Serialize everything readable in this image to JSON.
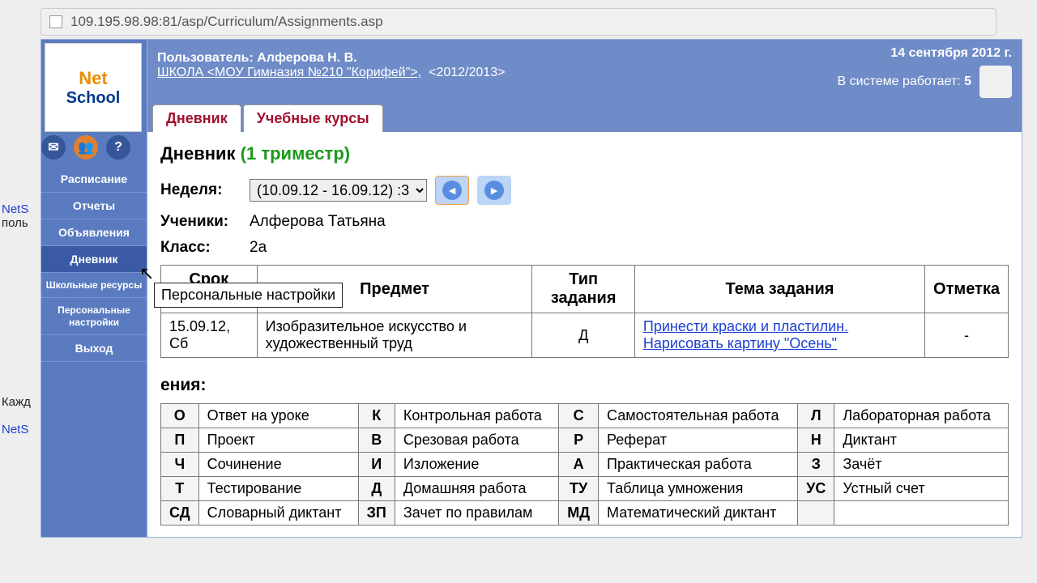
{
  "browser": {
    "url": "109.195.98.98:81/asp/Curriculum/Assignments.asp"
  },
  "header": {
    "user_label": "Пользователь:",
    "user_name": "Алферова Н. В.",
    "school": "ШКОЛА <МОУ Гимназия №210 \"Корифей\">,",
    "year": "<2012/2013>",
    "date": "14 сентября 2012 г.",
    "sys_label": "В системе работает:",
    "sys_count": "5"
  },
  "logo": {
    "net": "Net",
    "school": "School"
  },
  "sidebar": {
    "items": [
      {
        "label": "Расписание"
      },
      {
        "label": "Отчеты"
      },
      {
        "label": "Объявления"
      },
      {
        "label": "Дневник",
        "active": true
      },
      {
        "label": "Школьные ресурсы",
        "small": true
      },
      {
        "label": "Персональные настройки",
        "small": true
      },
      {
        "label": "Выход"
      }
    ]
  },
  "tabs": [
    {
      "label": "Дневник",
      "active": true
    },
    {
      "label": "Учебные курсы"
    }
  ],
  "page": {
    "title": "Дневник",
    "term": "(1 триместр)",
    "week_label": "Неделя:",
    "week_value": "(10.09.12 - 16.09.12) :3",
    "pupil_label": "Ученики:",
    "pupil_value": "Алферова Татьяна",
    "class_label": "Класс:",
    "class_value": "2а",
    "legend_title": "ения:"
  },
  "table": {
    "headers": [
      "Срок сдачи",
      "Предмет",
      "Тип задания",
      "Тема задания",
      "Отметка"
    ],
    "rows": [
      {
        "due": "15.09.12, Сб",
        "subject": "Изобразительное искусство и художественный труд",
        "type": "Д",
        "topic": "Принести краски и пластилин. Нарисовать картину \"Осень\"",
        "mark": "-"
      }
    ]
  },
  "legend": [
    [
      {
        "c": "О",
        "d": "Ответ на уроке"
      },
      {
        "c": "К",
        "d": "Контрольная работа"
      },
      {
        "c": "С",
        "d": "Самостоятельная работа"
      },
      {
        "c": "Л",
        "d": "Лабораторная работа"
      }
    ],
    [
      {
        "c": "П",
        "d": "Проект"
      },
      {
        "c": "В",
        "d": "Срезовая работа"
      },
      {
        "c": "Р",
        "d": "Реферат"
      },
      {
        "c": "Н",
        "d": "Диктант"
      }
    ],
    [
      {
        "c": "Ч",
        "d": "Сочинение"
      },
      {
        "c": "И",
        "d": "Изложение"
      },
      {
        "c": "А",
        "d": "Практическая работа"
      },
      {
        "c": "З",
        "d": "Зачёт"
      }
    ],
    [
      {
        "c": "Т",
        "d": "Тестирование"
      },
      {
        "c": "Д",
        "d": "Домашняя работа"
      },
      {
        "c": "ТУ",
        "d": "Таблица умножения"
      },
      {
        "c": "УС",
        "d": "Устный счет"
      }
    ],
    [
      {
        "c": "СД",
        "d": "Словарный диктант"
      },
      {
        "c": "ЗП",
        "d": "Зачет по правилам"
      },
      {
        "c": "МД",
        "d": "Математический диктант"
      },
      {
        "c": "",
        "d": ""
      }
    ]
  ],
  "tooltip": "Персональные настройки",
  "bg": {
    "nets1": "NetS",
    "pol": "поль",
    "kazh": "Кажд",
    "nets2": "NetS"
  }
}
